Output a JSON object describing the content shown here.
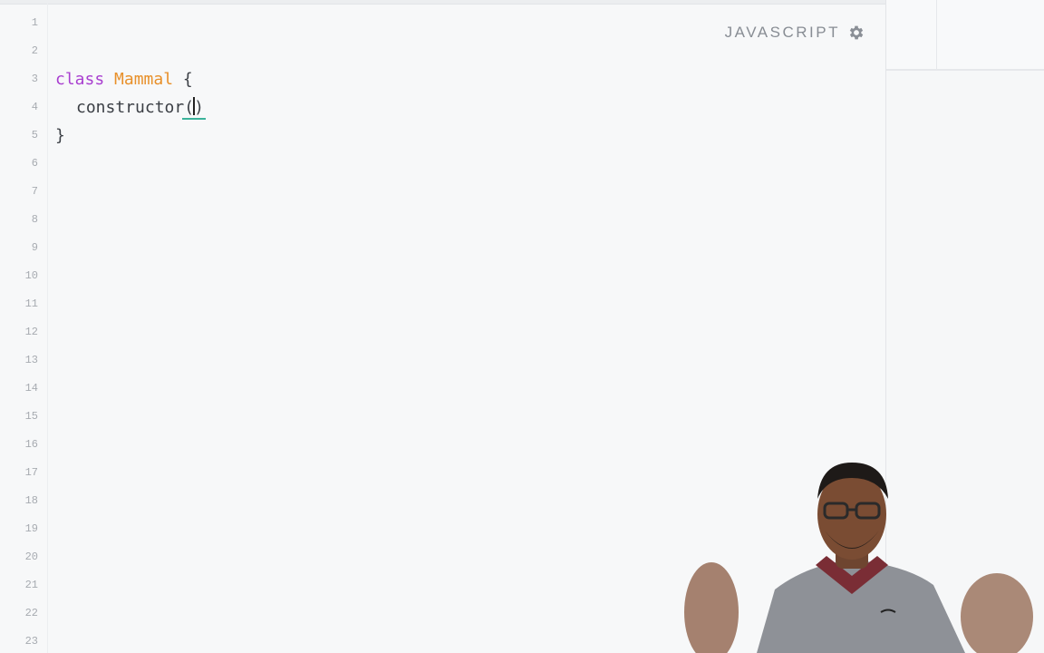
{
  "editor": {
    "language": "JAVASCRIPT",
    "line_numbers": [
      "1",
      "2",
      "3",
      "4",
      "5",
      "6",
      "7",
      "8",
      "9",
      "10",
      "11",
      "12",
      "13",
      "14",
      "15",
      "16",
      "17",
      "18",
      "19",
      "20",
      "21",
      "22",
      "23"
    ],
    "code": {
      "line3": {
        "keyword": "class",
        "name": "Mammal",
        "brace": "{"
      },
      "line4": {
        "text": "constructor",
        "open": "(",
        "close": ")"
      },
      "line5": {
        "brace": "}"
      }
    }
  },
  "colors": {
    "keyword": "#a93fd0",
    "class_name": "#e8902a",
    "bracket_match": "#3bb39a"
  },
  "icons": {
    "settings": "gear-icon"
  }
}
